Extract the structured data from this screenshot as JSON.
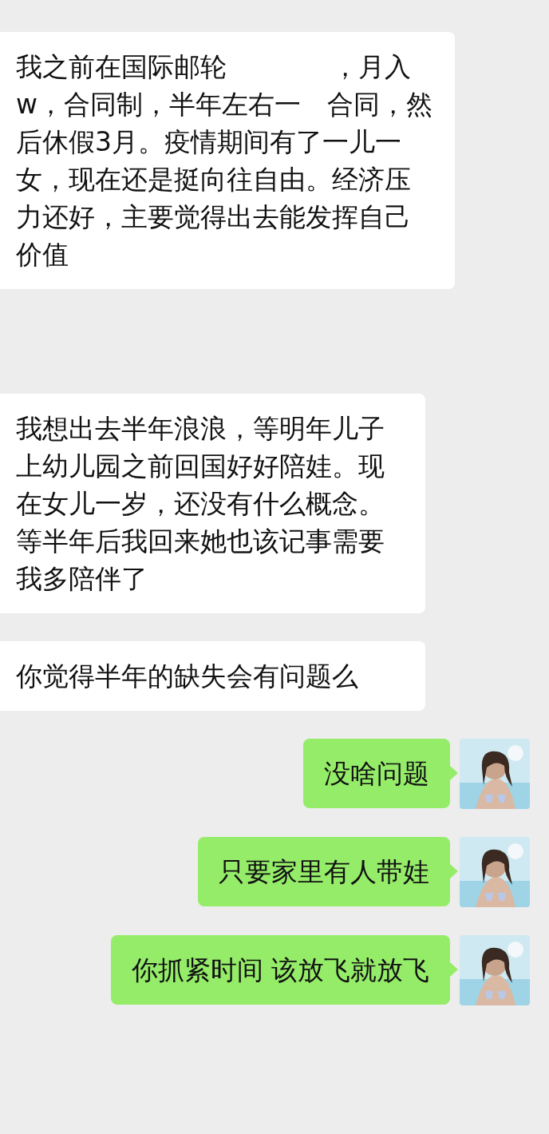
{
  "messages": [
    {
      "kind": "received",
      "text": "我之前在国际邮轮　　　　，月入　　w，合同制，半年左右一　合同，然后休假3月。疫情期间有了一儿一女，现在还是挺向往自由。经济压力还好，主要觉得出去能发挥自己价值"
    },
    {
      "kind": "received",
      "text": "我想出去半年浪浪，等明年儿子上幼儿园之前回国好好陪娃。现在女儿一岁，还没有什么概念。等半年后我回来她也该记事需要我多陪伴了"
    },
    {
      "kind": "received",
      "text": "你觉得半年的缺失会有问题么"
    },
    {
      "kind": "sent",
      "text": "没啥问题"
    },
    {
      "kind": "sent",
      "text": "只要家里有人带娃"
    },
    {
      "kind": "sent",
      "text": "你抓紧时间 该放飞就放飞"
    }
  ]
}
